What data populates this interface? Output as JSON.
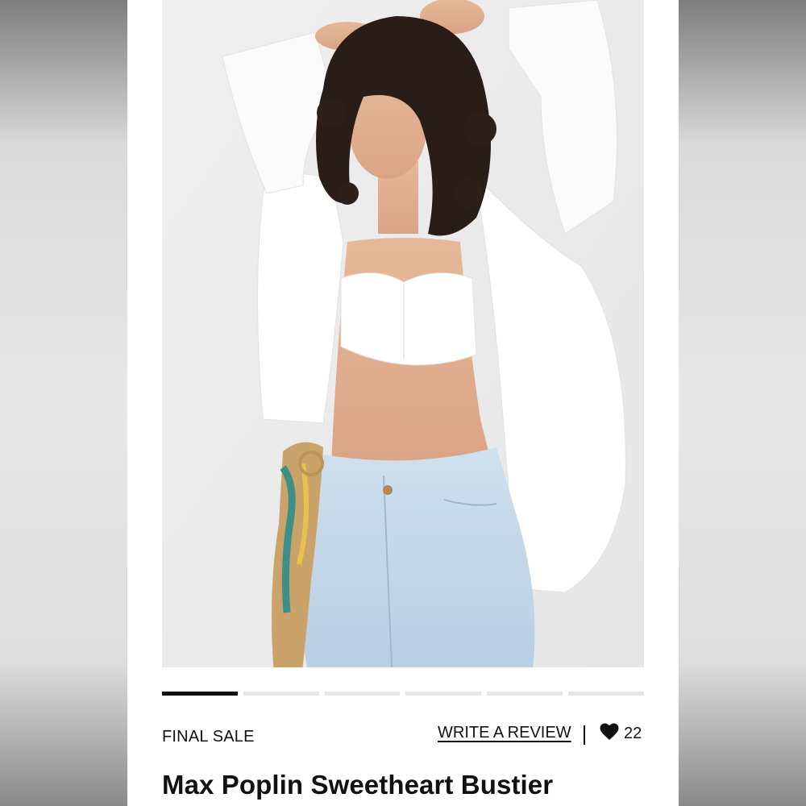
{
  "product": {
    "status_label": "FINAL SALE",
    "review_link_label": "WRITE A REVIEW",
    "separator": "|",
    "like_count": "22",
    "title": "Max Poplin Sweetheart Bustier"
  },
  "carousel": {
    "total_slides": 6,
    "active_index": 0
  },
  "icons": {
    "like": "heart-icon"
  },
  "colors": {
    "text": "#111111",
    "active_indicator": "#111111",
    "inactive_indicator": "#e7e7e7"
  }
}
